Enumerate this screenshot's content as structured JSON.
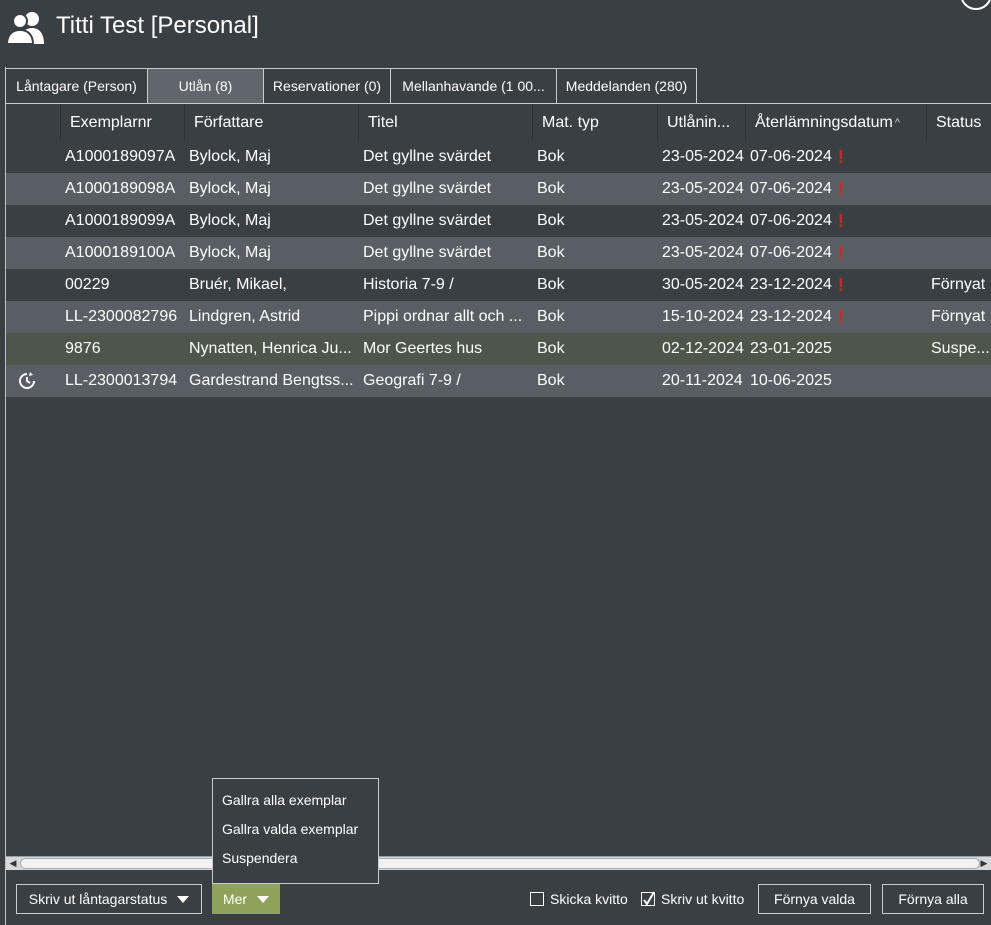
{
  "window": {
    "title": "Titti Test [Personal]"
  },
  "tabs": [
    {
      "label": "Låntagare (Person)",
      "active": false
    },
    {
      "label": "Utlån (8)",
      "active": true
    },
    {
      "label": "Reservationer (0)",
      "active": false
    },
    {
      "label": "Mellanhavande (1 00...",
      "active": false
    },
    {
      "label": "Meddelanden (280)",
      "active": false
    }
  ],
  "table": {
    "columns": [
      "",
      "Exemplarnr",
      "Författare",
      "Titel",
      "Mat. typ",
      "Utlånin...",
      "Återlämningsdatum",
      "Status"
    ],
    "sort_indicator": "^",
    "rows": [
      {
        "icon": "",
        "barcode": "A1000189097A",
        "author": "Bylock, Maj",
        "title": "Det gyllne svärdet",
        "type": "Bok",
        "loan_date": "23-05-2024",
        "due_date": "07-06-2024",
        "overdue": true,
        "status": ""
      },
      {
        "icon": "",
        "barcode": "A1000189098A",
        "author": "Bylock, Maj",
        "title": "Det gyllne svärdet",
        "type": "Bok",
        "loan_date": "23-05-2024",
        "due_date": "07-06-2024",
        "overdue": true,
        "status": ""
      },
      {
        "icon": "",
        "barcode": "A1000189099A",
        "author": "Bylock, Maj",
        "title": "Det gyllne svärdet",
        "type": "Bok",
        "loan_date": "23-05-2024",
        "due_date": "07-06-2024",
        "overdue": true,
        "status": ""
      },
      {
        "icon": "",
        "barcode": "A1000189100A",
        "author": "Bylock, Maj",
        "title": "Det gyllne svärdet",
        "type": "Bok",
        "loan_date": "23-05-2024",
        "due_date": "07-06-2024",
        "overdue": true,
        "status": ""
      },
      {
        "icon": "",
        "barcode": "00229",
        "author": "Bruér, Mikael,",
        "title": "Historia 7-9 /",
        "type": "Bok",
        "loan_date": "30-05-2024",
        "due_date": "23-12-2024",
        "overdue": true,
        "status": "Förnyat"
      },
      {
        "icon": "",
        "barcode": "LL-2300082796",
        "author": "Lindgren, Astrid",
        "title": "Pippi ordnar allt och ...",
        "type": "Bok",
        "loan_date": "15-10-2024",
        "due_date": "23-12-2024",
        "overdue": true,
        "status": "Förnyat"
      },
      {
        "icon": "",
        "barcode": "9876",
        "author": "Nynatten, Henrica Ju...",
        "title": "Mor Geertes hus",
        "type": "Bok",
        "loan_date": "02-12-2024",
        "due_date": "23-01-2025",
        "overdue": false,
        "status": "Suspe...",
        "highlight": true
      },
      {
        "icon": "clock-refresh-icon",
        "barcode": "LL-2300013794",
        "author": "Gardestrand Bengtss...",
        "title": "Geografi 7-9 /",
        "type": "Bok",
        "loan_date": "20-11-2024",
        "due_date": "10-06-2025",
        "overdue": false,
        "status": ""
      }
    ]
  },
  "overdue_mark": "!",
  "footer": {
    "print_status_label": "Skriv ut låntagarstatus",
    "more_label": "Mer",
    "send_receipt_label": "Skicka kvitto",
    "send_receipt_checked": false,
    "print_receipt_label": "Skriv ut kvitto",
    "print_receipt_checked": true,
    "renew_selected_label": "Förnya valda",
    "renew_all_label": "Förnya alla"
  },
  "more_menu": {
    "items": [
      "Gallra alla exemplar",
      "Gallra valda exemplar",
      "Suspendera"
    ]
  },
  "colors": {
    "background": "#3a3f43",
    "row_alt": "#585e63",
    "row_highlight": "#4d5648",
    "overdue": "#e0221e",
    "accent_green": "#8ea35a"
  }
}
